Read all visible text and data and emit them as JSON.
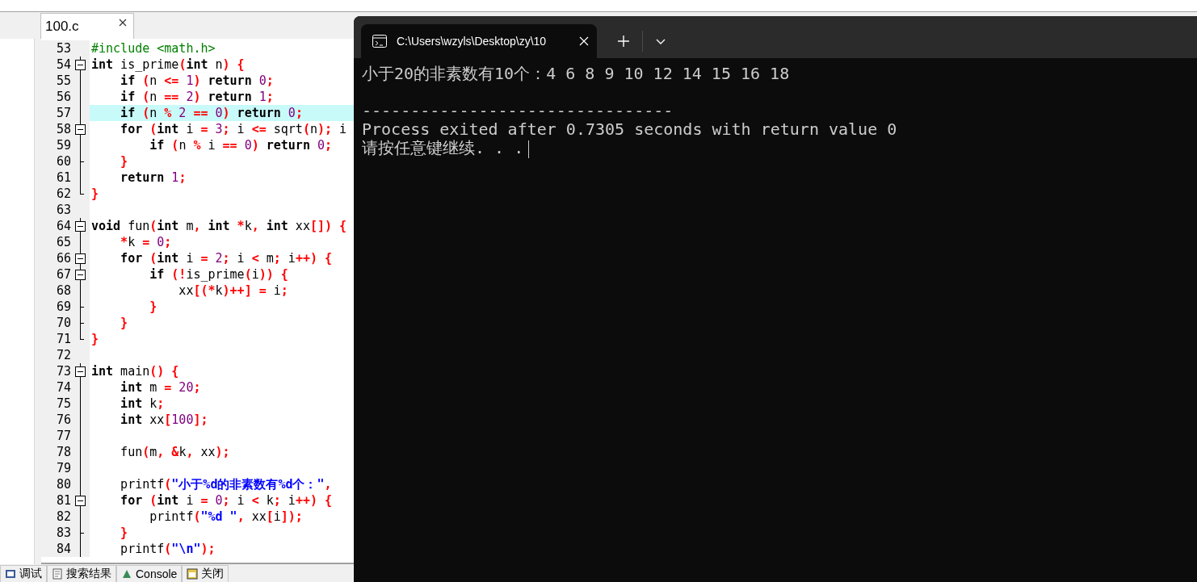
{
  "ide": {
    "editor_tab": {
      "label": "100.c",
      "selected": true
    },
    "code_lines": [
      {
        "number": "53",
        "kind": "plain",
        "highlighted": false,
        "tokens": [
          {
            "kind": "pre",
            "text": "#include <math.h>"
          }
        ]
      },
      {
        "number": "54",
        "kind": "fold_start",
        "highlighted": false,
        "tokens": [
          {
            "kind": "kw",
            "text": "int"
          },
          {
            "kind": "id",
            "text": " is_prime"
          },
          {
            "kind": "op",
            "text": "("
          },
          {
            "kind": "kw",
            "text": "int"
          },
          {
            "kind": "id",
            "text": " n"
          },
          {
            "kind": "op",
            "text": ")"
          },
          {
            "kind": "op",
            "text": " {"
          }
        ]
      },
      {
        "number": "55",
        "kind": "fold_line",
        "highlighted": false,
        "tokens": [
          {
            "kind": "kw",
            "text": "    if"
          },
          {
            "kind": "op",
            "text": " ("
          },
          {
            "kind": "id",
            "text": "n "
          },
          {
            "kind": "op",
            "text": "<="
          },
          {
            "kind": "num",
            "text": " 1"
          },
          {
            "kind": "op",
            "text": ")"
          },
          {
            "kind": "kw",
            "text": " return"
          },
          {
            "kind": "num",
            "text": " 0"
          },
          {
            "kind": "op",
            "text": ";"
          }
        ]
      },
      {
        "number": "56",
        "kind": "fold_line",
        "highlighted": false,
        "tokens": [
          {
            "kind": "kw",
            "text": "    if"
          },
          {
            "kind": "op",
            "text": " ("
          },
          {
            "kind": "id",
            "text": "n "
          },
          {
            "kind": "op",
            "text": "=="
          },
          {
            "kind": "num",
            "text": " 2"
          },
          {
            "kind": "op",
            "text": ")"
          },
          {
            "kind": "kw",
            "text": " return"
          },
          {
            "kind": "num",
            "text": " 1"
          },
          {
            "kind": "op",
            "text": ";"
          }
        ]
      },
      {
        "number": "57",
        "kind": "fold_line",
        "highlighted": true,
        "tokens": [
          {
            "kind": "kw",
            "text": "    if"
          },
          {
            "kind": "op",
            "text": " ("
          },
          {
            "kind": "id",
            "text": "n "
          },
          {
            "kind": "op",
            "text": "%"
          },
          {
            "kind": "num",
            "text": " 2"
          },
          {
            "kind": "op",
            "text": " =="
          },
          {
            "kind": "num",
            "text": " 0"
          },
          {
            "kind": "op",
            "text": ")"
          },
          {
            "kind": "kw",
            "text": " return"
          },
          {
            "kind": "num",
            "text": " 0"
          },
          {
            "kind": "op",
            "text": ";"
          }
        ]
      },
      {
        "number": "58",
        "kind": "fold_start",
        "highlighted": false,
        "tokens": [
          {
            "kind": "kw",
            "text": "    for"
          },
          {
            "kind": "op",
            "text": " ("
          },
          {
            "kind": "kw",
            "text": "int"
          },
          {
            "kind": "id",
            "text": " i "
          },
          {
            "kind": "op",
            "text": "="
          },
          {
            "kind": "num",
            "text": " 3"
          },
          {
            "kind": "op",
            "text": ";"
          },
          {
            "kind": "id",
            "text": " i "
          },
          {
            "kind": "op",
            "text": "<="
          },
          {
            "kind": "id",
            "text": " sqrt"
          },
          {
            "kind": "op",
            "text": "("
          },
          {
            "kind": "id",
            "text": "n"
          },
          {
            "kind": "op",
            "text": ");"
          },
          {
            "kind": "id",
            "text": " i"
          }
        ]
      },
      {
        "number": "59",
        "kind": "fold_line",
        "highlighted": false,
        "tokens": [
          {
            "kind": "kw",
            "text": "        if"
          },
          {
            "kind": "op",
            "text": " ("
          },
          {
            "kind": "id",
            "text": "n "
          },
          {
            "kind": "op",
            "text": "%"
          },
          {
            "kind": "id",
            "text": " i "
          },
          {
            "kind": "op",
            "text": "=="
          },
          {
            "kind": "num",
            "text": " 0"
          },
          {
            "kind": "op",
            "text": ")"
          },
          {
            "kind": "kw",
            "text": " return"
          },
          {
            "kind": "num",
            "text": " 0"
          },
          {
            "kind": "op",
            "text": ";"
          }
        ]
      },
      {
        "number": "60",
        "kind": "fold_branch",
        "highlighted": false,
        "tokens": [
          {
            "kind": "op",
            "text": "    }"
          }
        ]
      },
      {
        "number": "61",
        "kind": "fold_line",
        "highlighted": false,
        "tokens": [
          {
            "kind": "kw",
            "text": "    return"
          },
          {
            "kind": "num",
            "text": " 1"
          },
          {
            "kind": "op",
            "text": ";"
          }
        ]
      },
      {
        "number": "62",
        "kind": "fold_end",
        "highlighted": false,
        "tokens": [
          {
            "kind": "op",
            "text": "}"
          }
        ]
      },
      {
        "number": "63",
        "kind": "plain",
        "highlighted": false
      },
      {
        "number": "64",
        "kind": "fold_start",
        "highlighted": false,
        "tokens": [
          {
            "kind": "kw",
            "text": "void"
          },
          {
            "kind": "id",
            "text": " fun"
          },
          {
            "kind": "op",
            "text": "("
          },
          {
            "kind": "kw",
            "text": "int"
          },
          {
            "kind": "id",
            "text": " m"
          },
          {
            "kind": "op",
            "text": ","
          },
          {
            "kind": "kw",
            "text": " int"
          },
          {
            "kind": "op",
            "text": " *"
          },
          {
            "kind": "id",
            "text": "k"
          },
          {
            "kind": "op",
            "text": ","
          },
          {
            "kind": "kw",
            "text": " int"
          },
          {
            "kind": "id",
            "text": " xx"
          },
          {
            "kind": "op",
            "text": "[])"
          },
          {
            "kind": "op",
            "text": " {"
          }
        ]
      },
      {
        "number": "65",
        "kind": "fold_line",
        "highlighted": false,
        "tokens": [
          {
            "kind": "op",
            "text": "    *"
          },
          {
            "kind": "id",
            "text": "k "
          },
          {
            "kind": "op",
            "text": "="
          },
          {
            "kind": "num",
            "text": " 0"
          },
          {
            "kind": "op",
            "text": ";"
          }
        ]
      },
      {
        "number": "66",
        "kind": "fold_start",
        "highlighted": false,
        "tokens": [
          {
            "kind": "kw",
            "text": "    for"
          },
          {
            "kind": "op",
            "text": " ("
          },
          {
            "kind": "kw",
            "text": "int"
          },
          {
            "kind": "id",
            "text": " i "
          },
          {
            "kind": "op",
            "text": "="
          },
          {
            "kind": "num",
            "text": " 2"
          },
          {
            "kind": "op",
            "text": ";"
          },
          {
            "kind": "id",
            "text": " i "
          },
          {
            "kind": "op",
            "text": "<"
          },
          {
            "kind": "id",
            "text": " m"
          },
          {
            "kind": "op",
            "text": ";"
          },
          {
            "kind": "id",
            "text": " i"
          },
          {
            "kind": "op",
            "text": "++)"
          },
          {
            "kind": "op",
            "text": " {"
          }
        ]
      },
      {
        "number": "67",
        "kind": "fold_start",
        "highlighted": false,
        "tokens": [
          {
            "kind": "kw",
            "text": "        if"
          },
          {
            "kind": "op",
            "text": " (!"
          },
          {
            "kind": "id",
            "text": "is_prime"
          },
          {
            "kind": "op",
            "text": "("
          },
          {
            "kind": "id",
            "text": "i"
          },
          {
            "kind": "op",
            "text": "))"
          },
          {
            "kind": "op",
            "text": " {"
          }
        ]
      },
      {
        "number": "68",
        "kind": "fold_line",
        "highlighted": false,
        "tokens": [
          {
            "kind": "id",
            "text": "            xx"
          },
          {
            "kind": "op",
            "text": "[(*"
          },
          {
            "kind": "id",
            "text": "k"
          },
          {
            "kind": "op",
            "text": ")++]"
          },
          {
            "kind": "op",
            "text": " ="
          },
          {
            "kind": "id",
            "text": " i"
          },
          {
            "kind": "op",
            "text": ";"
          }
        ]
      },
      {
        "number": "69",
        "kind": "fold_branch",
        "highlighted": false,
        "tokens": [
          {
            "kind": "op",
            "text": "        }"
          }
        ]
      },
      {
        "number": "70",
        "kind": "fold_branch",
        "highlighted": false,
        "tokens": [
          {
            "kind": "op",
            "text": "    }"
          }
        ]
      },
      {
        "number": "71",
        "kind": "fold_end",
        "highlighted": false,
        "tokens": [
          {
            "kind": "op",
            "text": "}"
          }
        ]
      },
      {
        "number": "72",
        "kind": "plain",
        "highlighted": false
      },
      {
        "number": "73",
        "kind": "fold_start",
        "highlighted": false,
        "tokens": [
          {
            "kind": "kw",
            "text": "int"
          },
          {
            "kind": "id",
            "text": " main"
          },
          {
            "kind": "op",
            "text": "()"
          },
          {
            "kind": "op",
            "text": " {"
          }
        ]
      },
      {
        "number": "74",
        "kind": "fold_line",
        "highlighted": false,
        "tokens": [
          {
            "kind": "kw",
            "text": "    int"
          },
          {
            "kind": "id",
            "text": " m "
          },
          {
            "kind": "op",
            "text": "="
          },
          {
            "kind": "num",
            "text": " 20"
          },
          {
            "kind": "op",
            "text": ";"
          }
        ]
      },
      {
        "number": "75",
        "kind": "fold_line",
        "highlighted": false,
        "tokens": [
          {
            "kind": "kw",
            "text": "    int"
          },
          {
            "kind": "id",
            "text": " k"
          },
          {
            "kind": "op",
            "text": ";"
          }
        ]
      },
      {
        "number": "76",
        "kind": "fold_line",
        "highlighted": false,
        "tokens": [
          {
            "kind": "kw",
            "text": "    int"
          },
          {
            "kind": "id",
            "text": " xx"
          },
          {
            "kind": "op",
            "text": "["
          },
          {
            "kind": "num",
            "text": "100"
          },
          {
            "kind": "op",
            "text": "];"
          }
        ]
      },
      {
        "number": "77",
        "kind": "fold_line",
        "highlighted": false
      },
      {
        "number": "78",
        "kind": "fold_line",
        "highlighted": false,
        "tokens": [
          {
            "kind": "id",
            "text": "    fun"
          },
          {
            "kind": "op",
            "text": "("
          },
          {
            "kind": "id",
            "text": "m"
          },
          {
            "kind": "op",
            "text": ","
          },
          {
            "kind": "op",
            "text": " &"
          },
          {
            "kind": "id",
            "text": "k"
          },
          {
            "kind": "op",
            "text": ","
          },
          {
            "kind": "id",
            "text": " xx"
          },
          {
            "kind": "op",
            "text": ");"
          }
        ]
      },
      {
        "number": "79",
        "kind": "fold_line",
        "highlighted": false
      },
      {
        "number": "80",
        "kind": "fold_line",
        "highlighted": false,
        "tokens": [
          {
            "kind": "id",
            "text": "    printf"
          },
          {
            "kind": "op",
            "text": "("
          },
          {
            "kind": "str",
            "text": "\"小于%d的非素数有%d个：\""
          },
          {
            "kind": "op",
            "text": ","
          }
        ]
      },
      {
        "number": "81",
        "kind": "fold_start",
        "highlighted": false,
        "tokens": [
          {
            "kind": "kw",
            "text": "    for"
          },
          {
            "kind": "op",
            "text": " ("
          },
          {
            "kind": "kw",
            "text": "int"
          },
          {
            "kind": "id",
            "text": " i "
          },
          {
            "kind": "op",
            "text": "="
          },
          {
            "kind": "num",
            "text": " 0"
          },
          {
            "kind": "op",
            "text": ";"
          },
          {
            "kind": "id",
            "text": " i "
          },
          {
            "kind": "op",
            "text": "<"
          },
          {
            "kind": "id",
            "text": " k"
          },
          {
            "kind": "op",
            "text": ";"
          },
          {
            "kind": "id",
            "text": " i"
          },
          {
            "kind": "op",
            "text": "++)"
          },
          {
            "kind": "op",
            "text": " {"
          }
        ]
      },
      {
        "number": "82",
        "kind": "fold_line",
        "highlighted": false,
        "tokens": [
          {
            "kind": "id",
            "text": "        printf"
          },
          {
            "kind": "op",
            "text": "("
          },
          {
            "kind": "str",
            "text": "\"%d \""
          },
          {
            "kind": "op",
            "text": ","
          },
          {
            "kind": "id",
            "text": " xx"
          },
          {
            "kind": "op",
            "text": "["
          },
          {
            "kind": "id",
            "text": "i"
          },
          {
            "kind": "op",
            "text": "]);"
          }
        ]
      },
      {
        "number": "83",
        "kind": "fold_branch",
        "highlighted": false,
        "tokens": [
          {
            "kind": "op",
            "text": "    }"
          }
        ]
      },
      {
        "number": "84",
        "kind": "fold_line",
        "highlighted": false,
        "tokens": [
          {
            "kind": "id",
            "text": "    printf"
          },
          {
            "kind": "op",
            "text": "("
          },
          {
            "kind": "str",
            "text": "\"\\n\""
          },
          {
            "kind": "op",
            "text": ");"
          }
        ]
      }
    ],
    "bottom_tabs": [
      {
        "label": "调试",
        "kind": "debug"
      },
      {
        "label": "搜索结果",
        "kind": "search"
      },
      {
        "label": "Console",
        "kind": "console"
      },
      {
        "label": "关闭",
        "kind": "close"
      }
    ]
  },
  "terminal": {
    "tab": {
      "title": "C:\\Users\\wzyls\\Desktop\\zy\\10",
      "selected": true
    },
    "program_output": "小于20的非素数有10个：4 6 8 9 10 12 14 15 16 18",
    "separator": "--------------------------------",
    "exit_message": "Process exited after 0.7305 seconds with return value 0",
    "prompt": "请按任意键继续. . ."
  }
}
